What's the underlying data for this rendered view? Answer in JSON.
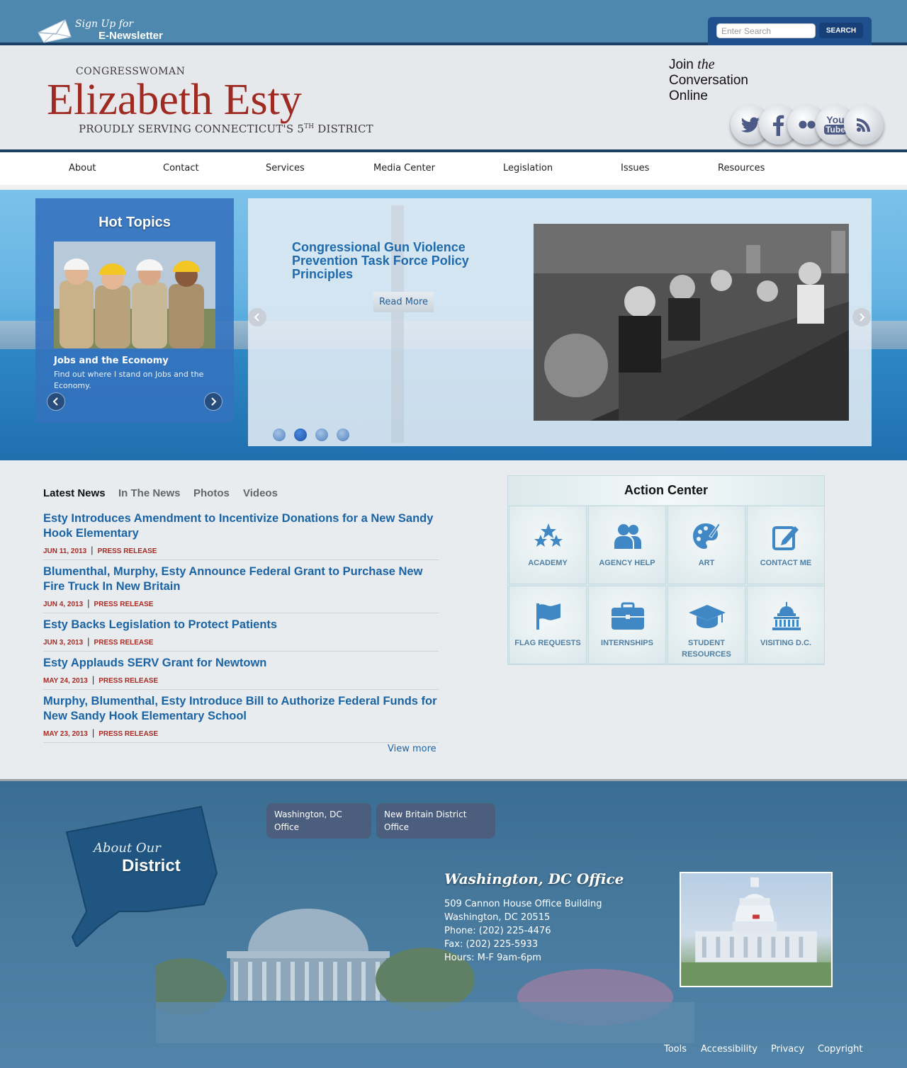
{
  "top": {
    "newsletter_line1": "Sign Up for",
    "newsletter_line2": "E-Newsletter",
    "search_placeholder": "Enter Search",
    "search_button": "SEARCH"
  },
  "header": {
    "title_small": "CONGRESSWOMAN",
    "name": "Elizabeth Esty",
    "tagline_pre": "PROUDLY SERVING CONNECTICUT'S ",
    "tagline_num": "5",
    "tagline_sup": "TH",
    "tagline_post": " DISTRICT",
    "join_1": "Join",
    "join_the": "the",
    "join_2": "Conversation",
    "join_3": "Online",
    "social": [
      "twitter",
      "facebook",
      "flickr",
      "youtube",
      "rss"
    ],
    "youtube_top": "You",
    "youtube_bottom": "Tube"
  },
  "nav": [
    "About",
    "Contact",
    "Services",
    "Media Center",
    "Legislation",
    "Issues",
    "Resources"
  ],
  "hot_topics": {
    "heading": "Hot Topics",
    "item_title": "Jobs and the Economy",
    "item_desc": "Find out where I stand on Jobs and the Economy."
  },
  "slider": {
    "title": "Congressional Gun Violence Prevention Task Force Policy Principles",
    "read_more": "Read More",
    "dots": 4,
    "active_dot": 2
  },
  "news": {
    "tabs": [
      "Latest News",
      "In The News",
      "Photos",
      "Videos"
    ],
    "active_tab": "Latest News",
    "items": [
      {
        "title": "Esty Introduces Amendment to Incentivize Donations for a New Sandy Hook Elementary",
        "date": "JUN 11, 2013",
        "type": "PRESS RELEASE"
      },
      {
        "title": "Blumenthal, Murphy, Esty Announce Federal Grant to Purchase New Fire Truck In New Britain",
        "date": "JUN 4, 2013",
        "type": "PRESS RELEASE"
      },
      {
        "title": "Esty Backs Legislation to Protect Patients",
        "date": "JUN 3, 2013",
        "type": "PRESS RELEASE"
      },
      {
        "title": "Esty Applauds SERV Grant for Newtown",
        "date": "MAY 24, 2013",
        "type": "PRESS RELEASE"
      },
      {
        "title": "Murphy, Blumenthal, Esty Introduce Bill to Authorize Federal Funds for New Sandy Hook Elementary School",
        "date": "MAY 23, 2013",
        "type": "PRESS RELEASE"
      }
    ],
    "view_more": "View more"
  },
  "action_center": {
    "heading": "Action Center",
    "tiles": [
      {
        "label": "ACADEMY",
        "icon": "stars-icon"
      },
      {
        "label": "AGENCY HELP",
        "icon": "people-icon"
      },
      {
        "label": "ART",
        "icon": "palette-icon"
      },
      {
        "label": "CONTACT ME",
        "icon": "edit-icon"
      },
      {
        "label": "FLAG REQUESTS",
        "icon": "flag-icon"
      },
      {
        "label": "INTERNSHIPS",
        "icon": "briefcase-icon"
      },
      {
        "label": "STUDENT RESOURCES",
        "icon": "graduation-cap-icon"
      },
      {
        "label": "VISITING D.C.",
        "icon": "capitol-icon"
      }
    ]
  },
  "footer": {
    "about_1": "About Our",
    "about_2": "District",
    "office_tabs": [
      "Washington, DC Office",
      "New Britain District Office"
    ],
    "office_title": "Washington, DC Office",
    "address_1": "509 Cannon House Office Building",
    "address_2": "Washington, DC 20515",
    "phone": "Phone: (202) 225-4476",
    "fax": "Fax: (202) 225-5933",
    "hours": "Hours: M-F 9am-6pm",
    "links": [
      "Tools",
      "Accessibility",
      "Privacy",
      "Copyright"
    ]
  }
}
